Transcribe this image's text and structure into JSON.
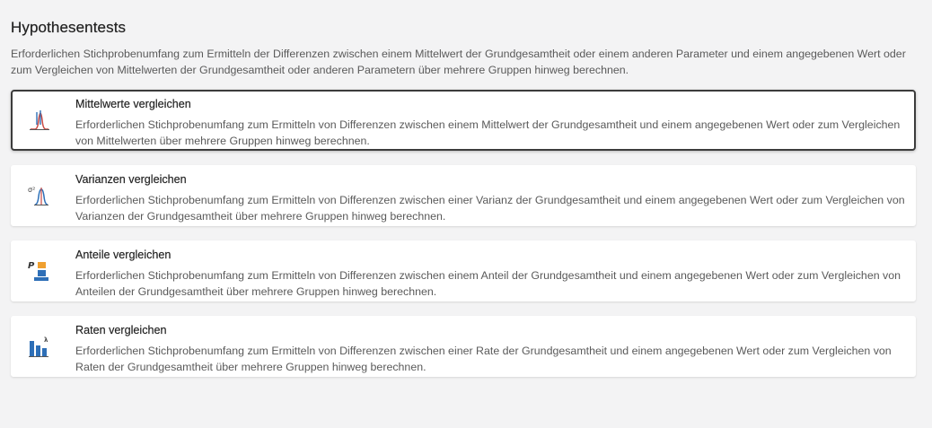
{
  "header": {
    "title": "Hypothesentests",
    "description": "Erforderlichen Stichprobenumfang zum Ermitteln der Differenzen zwischen einem Mittelwert der Grundgesamtheit oder einem anderen Parameter und einem angegebenen Wert oder zum Vergleichen von Mittelwerten der Grundgesamtheit oder anderen Parametern über mehrere Gruppen hinweg berechnen."
  },
  "cards": [
    {
      "title": "Mittelwerte vergleichen",
      "description": "Erforderlichen Stichprobenumfang zum Ermitteln von Differenzen zwischen einem Mittelwert der Grundgesamtheit und einem angegebenen Wert oder zum Vergleichen von Mittelwerten über mehrere Gruppen hinweg berechnen.",
      "icon": "compare-means-icon",
      "selected": true
    },
    {
      "title": "Varianzen vergleichen",
      "description": "Erforderlichen Stichprobenumfang zum Ermitteln von Differenzen zwischen einer Varianz der Grundgesamtheit und einem angegebenen Wert oder zum Vergleichen von Varianzen der Grundgesamtheit über mehrere Gruppen hinweg berechnen.",
      "icon": "compare-variances-icon",
      "selected": false
    },
    {
      "title": "Anteile vergleichen",
      "description": "Erforderlichen Stichprobenumfang zum Ermitteln von Differenzen zwischen einem Anteil der Grundgesamtheit und einem angegebenen Wert oder zum Vergleichen von Anteilen der Grundgesamtheit über mehrere Gruppen hinweg berechnen.",
      "icon": "compare-proportions-icon",
      "selected": false
    },
    {
      "title": "Raten vergleichen",
      "description": "Erforderlichen Stichprobenumfang zum Ermitteln von Differenzen zwischen einer Rate der Grundgesamtheit und einem angegebenen Wert oder zum Vergleichen von Raten der Grundgesamtheit über mehrere Gruppen hinweg berechnen.",
      "icon": "compare-rates-icon",
      "selected": false
    }
  ],
  "colors": {
    "background": "#f3f3f4",
    "card": "#ffffff",
    "selected_border": "#3c3c3c",
    "icon_blue": "#2e6fb7",
    "icon_red": "#d9534f",
    "icon_orange": "#f0a030"
  }
}
